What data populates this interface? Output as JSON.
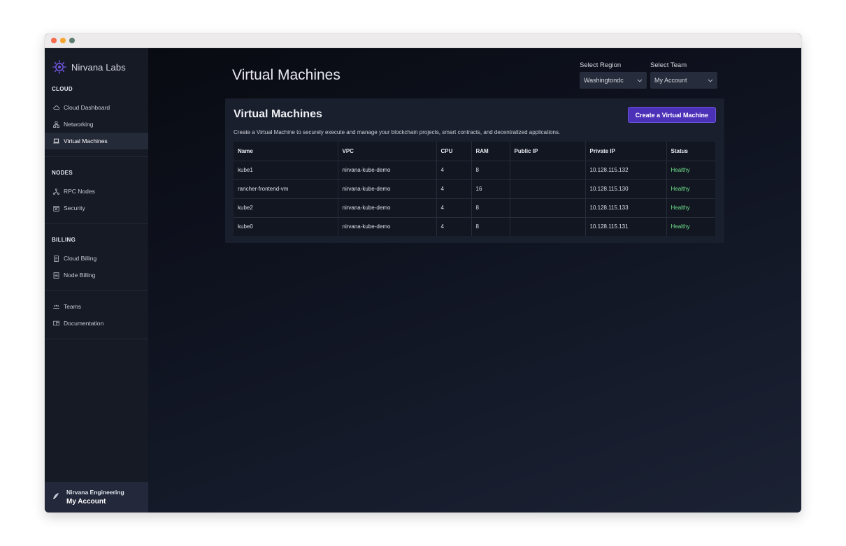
{
  "window": {
    "dots": [
      "#f46a4b",
      "#f6a531",
      "#5e7d6e"
    ]
  },
  "sidebar": {
    "brand": "Nirvana Labs",
    "sections": [
      {
        "title": "CLOUD",
        "items": [
          {
            "label": "Cloud Dashboard",
            "icon": "cloud-icon",
            "active": false
          },
          {
            "label": "Networking",
            "icon": "network-icon",
            "active": false
          },
          {
            "label": "Virtual Machines",
            "icon": "laptop-icon",
            "active": true
          }
        ]
      },
      {
        "title": "NODES",
        "items": [
          {
            "label": "RPC Nodes",
            "icon": "nodes-icon",
            "active": false
          },
          {
            "label": "Security",
            "icon": "security-icon",
            "active": false
          }
        ]
      },
      {
        "title": "BILLING",
        "items": [
          {
            "label": "Cloud Billing",
            "icon": "billing-icon",
            "active": false
          },
          {
            "label": "Node Billing",
            "icon": "receipt-icon",
            "active": false
          }
        ]
      },
      {
        "title": "",
        "items": [
          {
            "label": "Teams",
            "icon": "team-icon",
            "active": false
          },
          {
            "label": "Documentation",
            "icon": "docs-icon",
            "active": false
          }
        ]
      }
    ],
    "footer": {
      "org": "Nirvana Engineering",
      "account": "My Account"
    }
  },
  "header": {
    "title": "Virtual Machines",
    "region": {
      "label": "Select Region",
      "value": "Washingtondc"
    },
    "team": {
      "label": "Select Team",
      "value": "My Account"
    }
  },
  "card": {
    "title": "Virtual Machines",
    "description": "Create a Virtual Machine to securely execute and manage your blockchain projects, smart contracts, and decentralized applications.",
    "create_label": "Create a Virtual Machine",
    "columns": [
      "Name",
      "VPC",
      "CPU",
      "RAM",
      "Public IP",
      "Private IP",
      "Status"
    ],
    "rows": [
      {
        "name": "kube1",
        "vpc": "nirvana-kube-demo",
        "cpu": "4",
        "ram": "8",
        "public_ip": "",
        "private_ip": "10.128.115.132",
        "status": "Healthy"
      },
      {
        "name": "rancher-frontend-vm",
        "vpc": "nirvana-kube-demo",
        "cpu": "4",
        "ram": "16",
        "public_ip": "",
        "private_ip": "10.128.115.130",
        "status": "Healthy"
      },
      {
        "name": "kube2",
        "vpc": "nirvana-kube-demo",
        "cpu": "4",
        "ram": "8",
        "public_ip": "",
        "private_ip": "10.128.115.133",
        "status": "Healthy"
      },
      {
        "name": "kube0",
        "vpc": "nirvana-kube-demo",
        "cpu": "4",
        "ram": "8",
        "public_ip": "",
        "private_ip": "10.128.115.131",
        "status": "Healthy"
      }
    ]
  }
}
